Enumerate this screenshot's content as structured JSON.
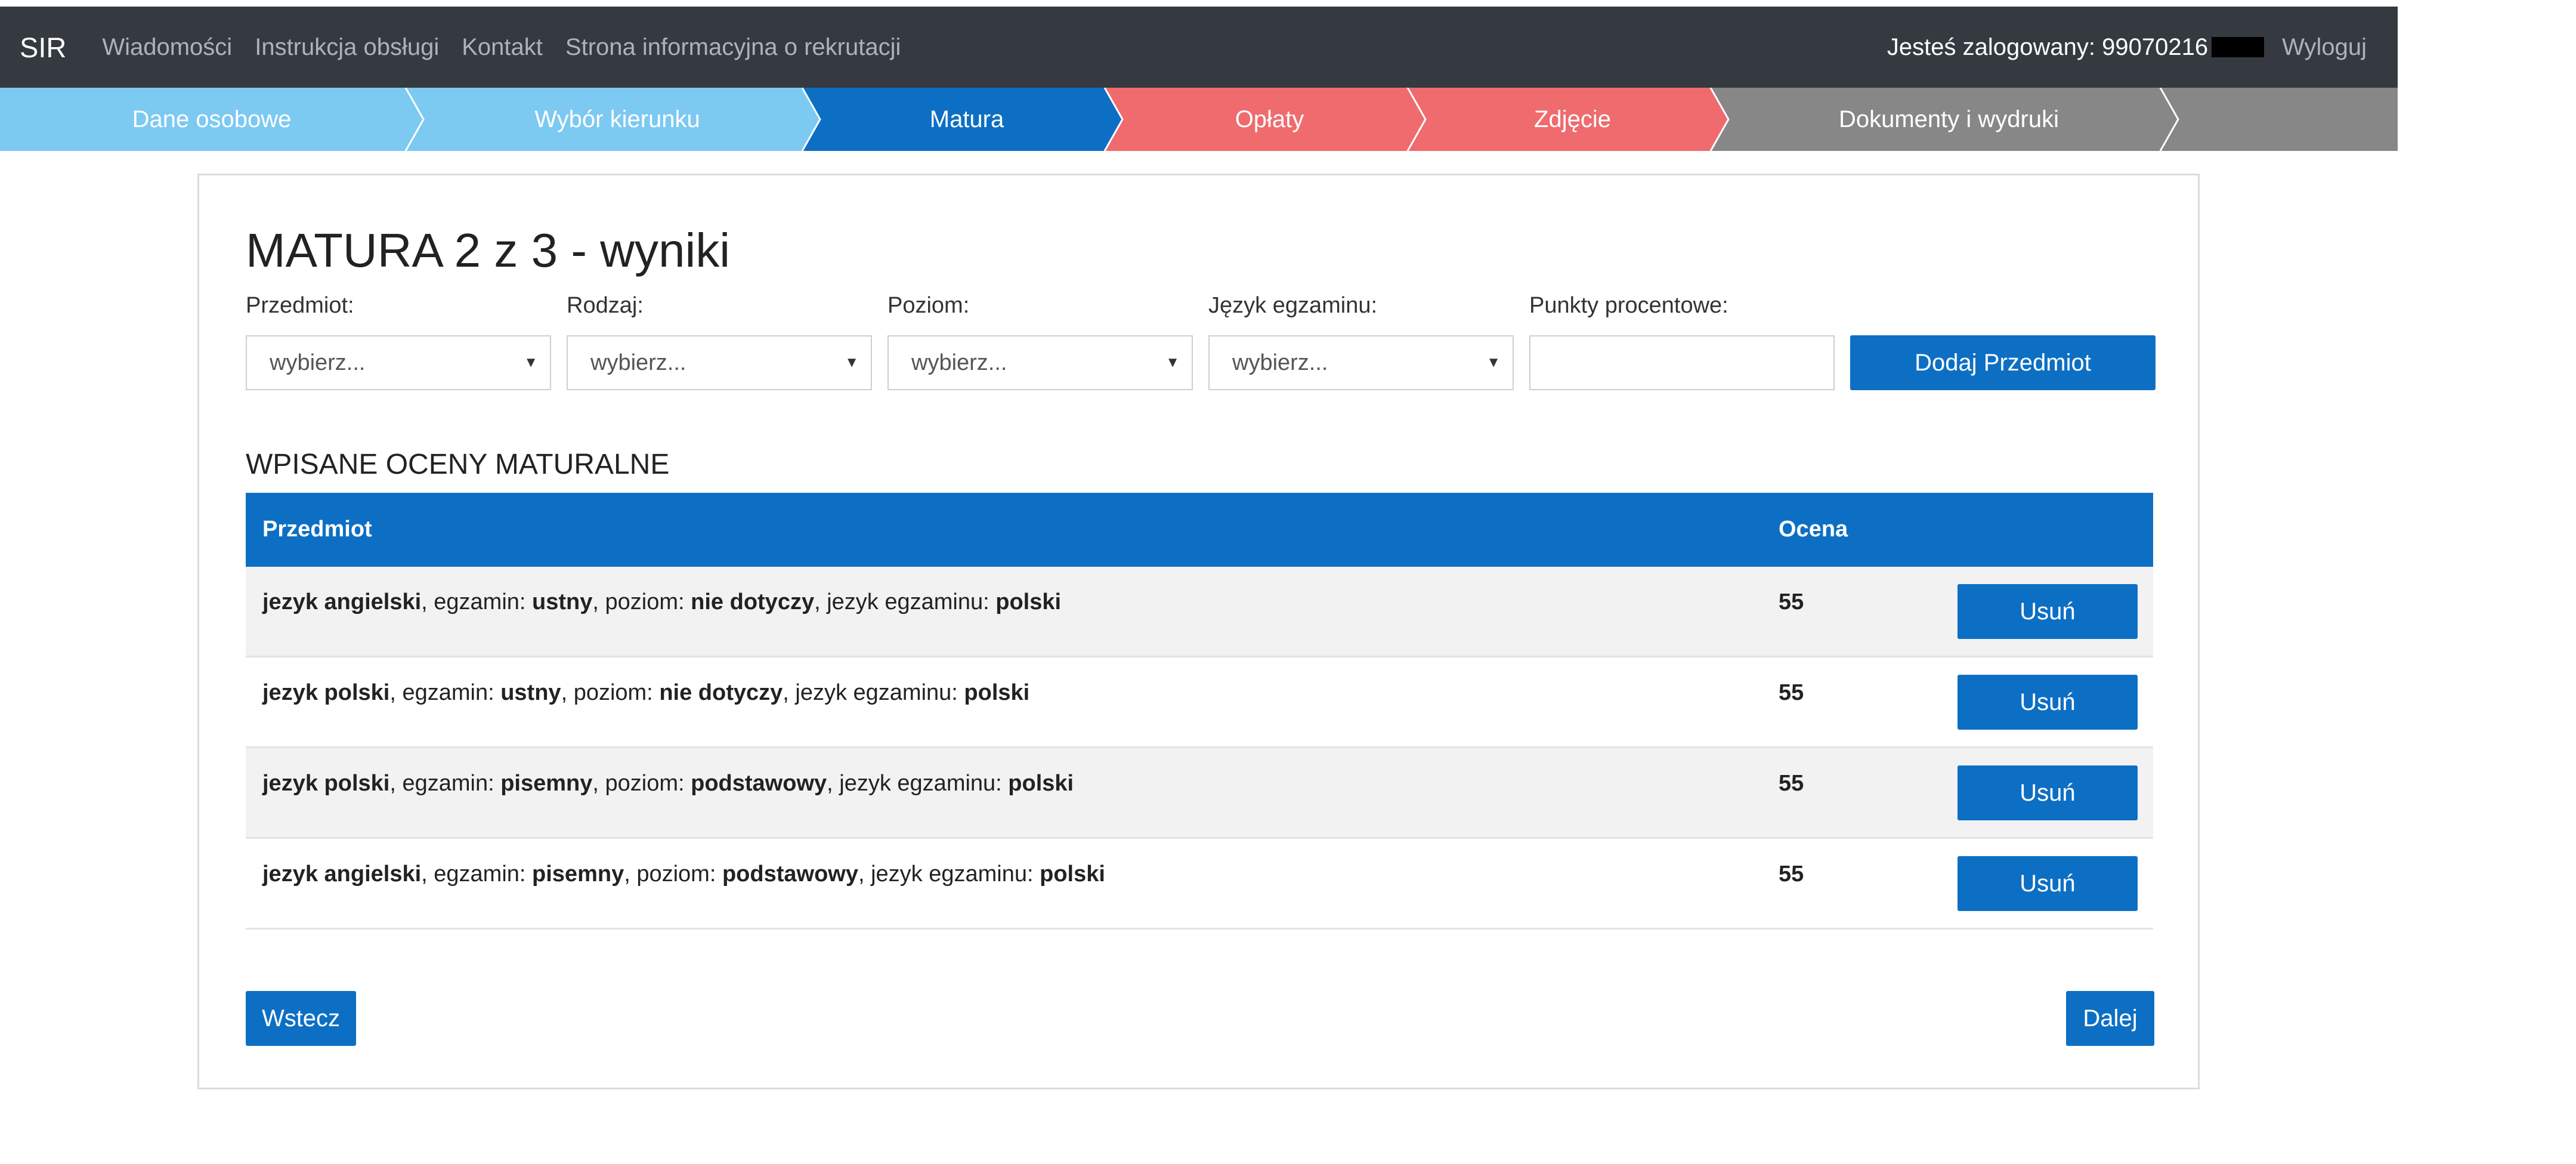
{
  "navbar": {
    "brand": "SIR",
    "links": [
      "Wiadomości",
      "Instrukcja obsługi",
      "Kontakt",
      "Strona informacyjna o rekrutacji"
    ],
    "user_label": "Jesteś zalogowany: 99070216",
    "logout": "Wyloguj"
  },
  "steps": [
    {
      "label": "Dane osobowe",
      "color": "#7cc9f2"
    },
    {
      "label": "Wybór kierunku",
      "color": "#7cc9f2"
    },
    {
      "label": "Matura",
      "color": "#0d6fc4"
    },
    {
      "label": "Opłaty",
      "color": "#ef6b6e"
    },
    {
      "label": "Zdjęcie",
      "color": "#ef6b6e"
    },
    {
      "label": "Dokumenty i wydruki",
      "color": "#878787"
    }
  ],
  "colors": {
    "primary": "#0d6fc4",
    "separator": "#ffffff"
  },
  "page": {
    "title": "MATURA 2 z 3 - wyniki",
    "form": {
      "subject_label": "Przedmiot:",
      "subject_value": "wybierz...",
      "type_label": "Rodzaj:",
      "type_value": "wybierz...",
      "level_label": "Poziom:",
      "level_value": "wybierz...",
      "language_label": "Język egzaminu:",
      "language_value": "wybierz...",
      "points_label": "Punkty procentowe:",
      "points_value": "",
      "add_button": "Dodaj Przedmiot"
    },
    "section_title": "WPISANE OCENY MATURALNE",
    "table": {
      "headers": {
        "subject": "Przedmiot",
        "grade": "Ocena"
      },
      "sep": ", ",
      "exam_label": "egzamin: ",
      "level_label": "poziom: ",
      "language_label": "jezyk egzaminu: ",
      "delete_label": "Usuń",
      "rows": [
        {
          "subject": "jezyk angielski",
          "exam": "ustny",
          "level": "nie dotyczy",
          "language": "polski",
          "grade": "55"
        },
        {
          "subject": "jezyk polski",
          "exam": "ustny",
          "level": "nie dotyczy",
          "language": "polski",
          "grade": "55"
        },
        {
          "subject": "jezyk polski",
          "exam": "pisemny",
          "level": "podstawowy",
          "language": "polski",
          "grade": "55"
        },
        {
          "subject": "jezyk angielski",
          "exam": "pisemny",
          "level": "podstawowy",
          "language": "polski",
          "grade": "55"
        }
      ]
    },
    "back_button": "Wstecz",
    "next_button": "Dalej"
  }
}
